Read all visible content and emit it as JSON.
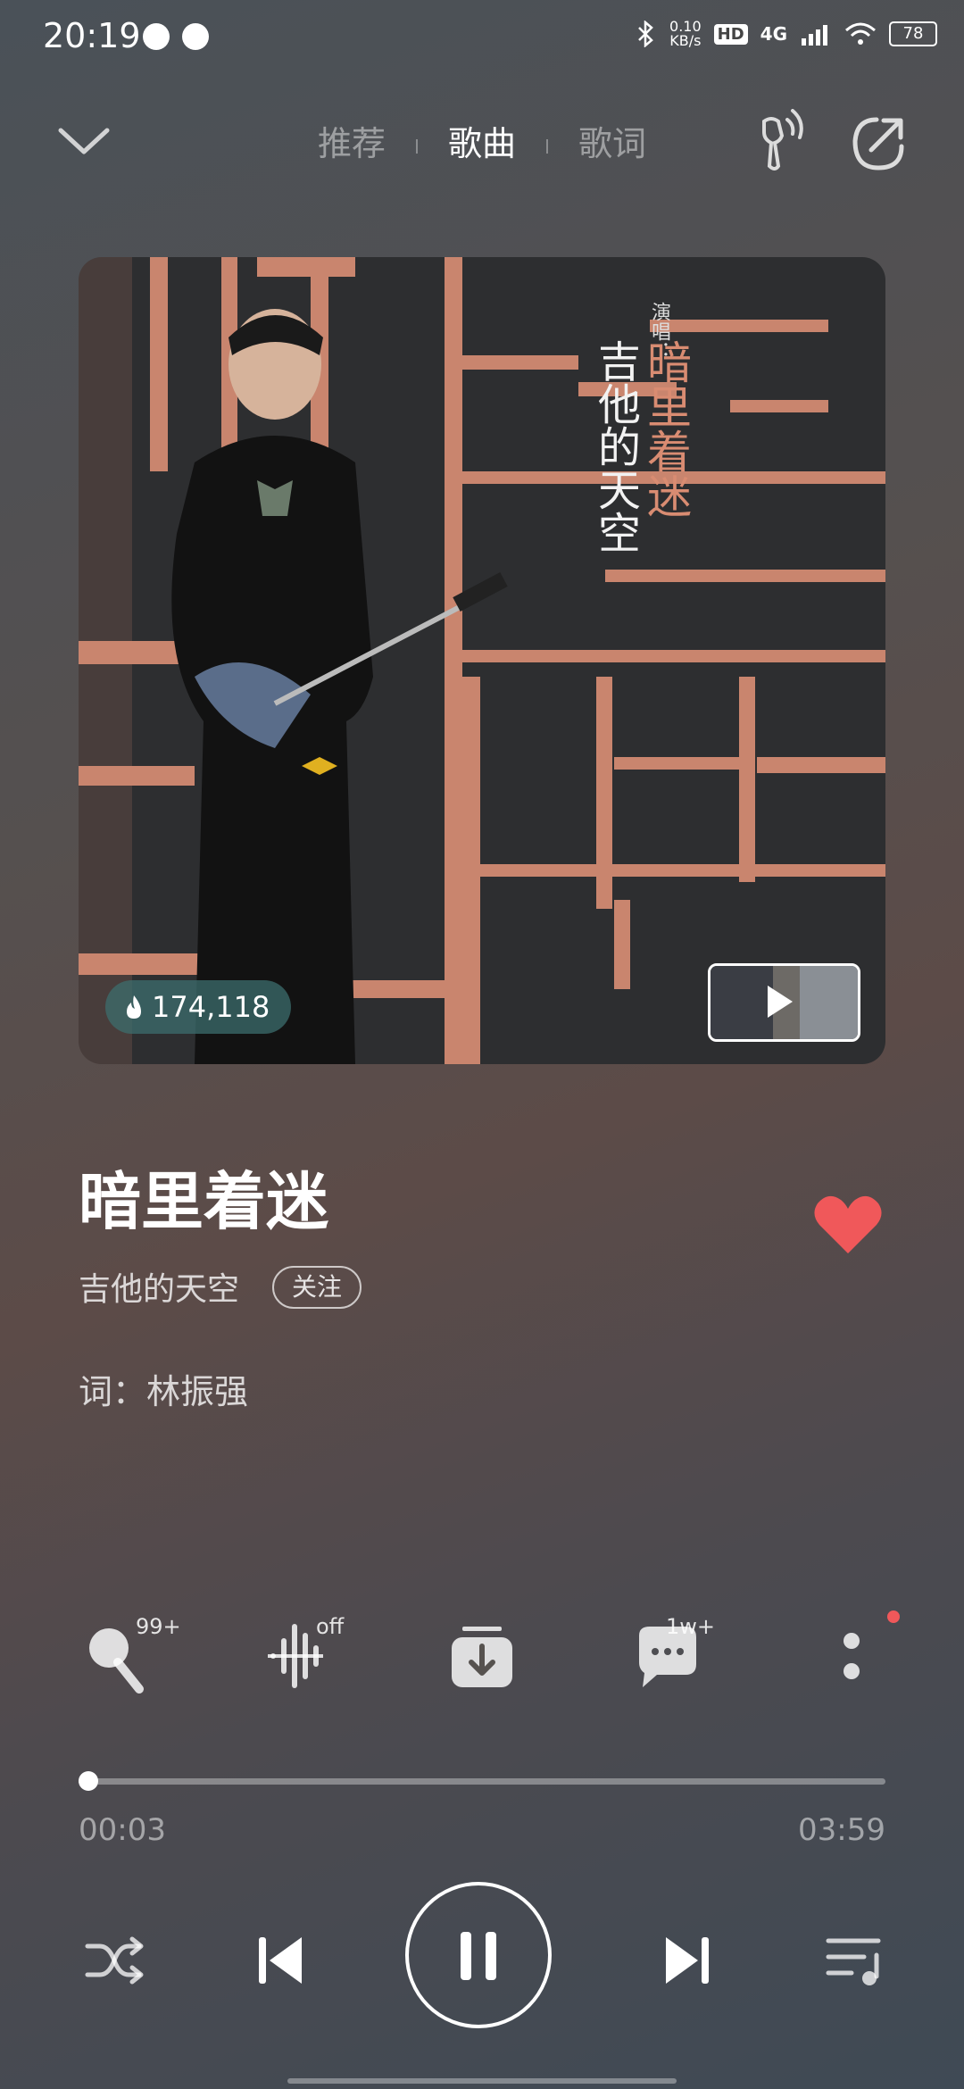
{
  "status_bar": {
    "time": "20:19",
    "net_speed_value": "0.10",
    "net_speed_unit": "KB/s",
    "hd_label": "HD",
    "signal_label": "4G",
    "battery": "78"
  },
  "header": {
    "tabs": [
      {
        "label": "推荐",
        "active": false
      },
      {
        "label": "歌曲",
        "active": true
      },
      {
        "label": "歌词",
        "active": false
      }
    ]
  },
  "cover": {
    "sing_label": "演唱：",
    "artist_vertical": "吉他的天空",
    "title_vertical": "暗里着迷",
    "heat_count": "174,118",
    "accent_color": "#c9856e"
  },
  "song": {
    "title": "暗里着迷",
    "artist": "吉他的天空",
    "follow_label": "关注",
    "lyricist": "词：林振强",
    "liked": true,
    "like_color": "#f0585a"
  },
  "actions": {
    "karaoke_badge": "99+",
    "effect_badge": "off",
    "comments_badge": "1w+"
  },
  "progress": {
    "current": "00:03",
    "total": "03:59",
    "fraction": 0.0125
  }
}
